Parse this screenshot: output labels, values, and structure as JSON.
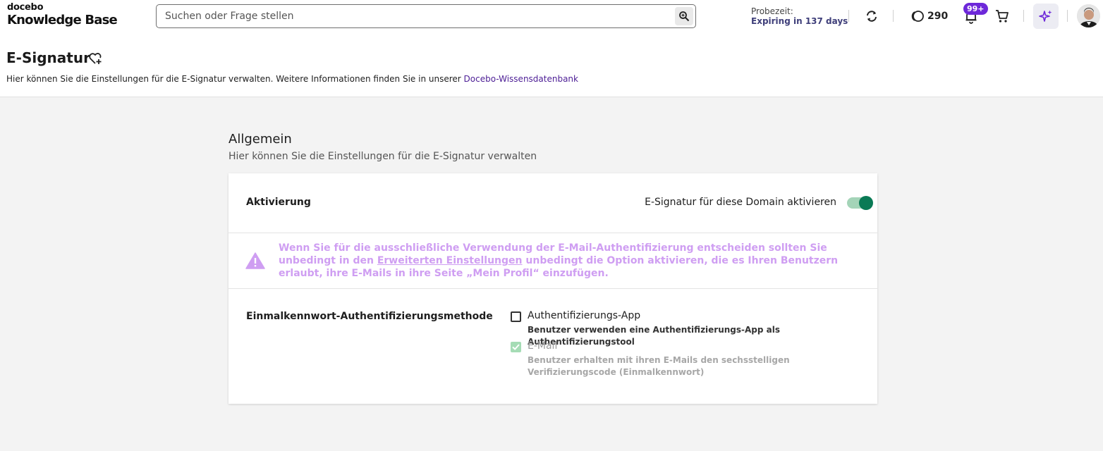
{
  "header": {
    "brand": "docebo",
    "product": "Knowledge Base",
    "search_placeholder": "Suchen oder Frage stellen",
    "trial_label": "Probezeit:",
    "trial_status": "Expiring in 137 days",
    "credits": "290",
    "notification_badge": "99+"
  },
  "page": {
    "title": "E-Signatur",
    "description": "Hier können Sie die Einstellungen für die E-Signatur verwalten. Weitere Informationen finden Sie in unserer ",
    "description_link": "Docebo-Wissensdatenbank"
  },
  "section": {
    "title": "Allgemein",
    "description": "Hier können Sie die Einstellungen für die E-Signatur verwalten"
  },
  "activation": {
    "label": "Aktivierung",
    "toggle_label": "E-Signatur für diese Domain aktivieren",
    "enabled": true
  },
  "warning": {
    "text_before": "Wenn Sie für die ausschließliche Verwendung der E-Mail-Authentifizierung entscheiden sollten Sie unbedingt in den ",
    "link": "Erweiterten Einstellungen",
    "text_after": " unbedingt die Option aktivieren, die es Ihren Benutzern erlaubt, ihre E-Mails in ihre Seite „Mein Profil“ einzufügen."
  },
  "otp": {
    "label": "Einmalkennwort-Authentifizierungsmethode",
    "options": [
      {
        "label": "Authentifizierungs-App",
        "description": "Benutzer verwenden eine Authentifizierungs-App als Authentifizierungstool",
        "checked": false,
        "disabled": false
      },
      {
        "label": "E-Mail",
        "description": "Benutzer erhalten mit ihren E-Mails den sechsstelligen Verifizierungscode (Einmalkennwort)",
        "checked": true,
        "disabled": true
      }
    ]
  },
  "colors": {
    "accent": "#6d28d9",
    "toggle_on": "#0a7a55",
    "warning": "#cf9ef2",
    "link": "#4c1d95"
  }
}
